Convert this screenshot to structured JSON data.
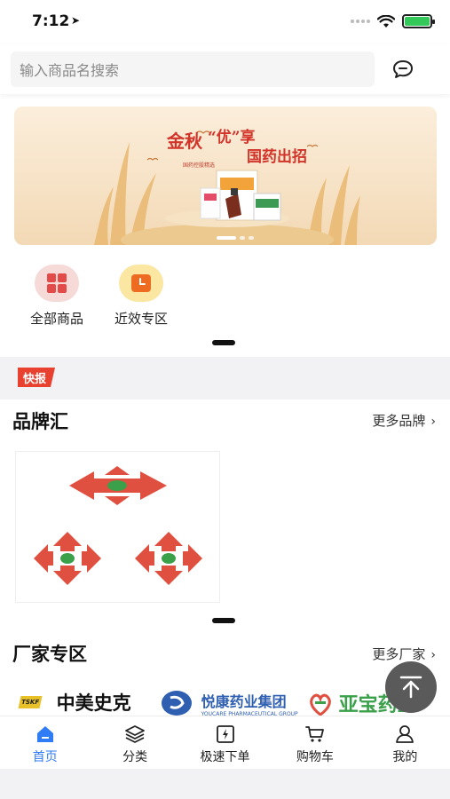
{
  "status": {
    "time": "7:12",
    "battery_level": 1.0
  },
  "search": {
    "placeholder": "输入商品名搜索",
    "chat_icon": "chat-bubble-icon"
  },
  "banner": {
    "headline_part1": "金秋",
    "headline_quote": "“优”享",
    "headline_part2": "国药出招",
    "sub": "国药控股精选",
    "slide_count": 3,
    "active_slide": 1
  },
  "quick_links": [
    {
      "label": "全部商品",
      "icon": "grid-icon",
      "color": "#f6dad8"
    },
    {
      "label": "近效专区",
      "icon": "clock-icon",
      "color": "#fbe6a2"
    }
  ],
  "news": {
    "badge": "快报"
  },
  "brands": {
    "title": "品牌汇",
    "more": "更多品牌"
  },
  "manufacturers": {
    "title": "厂家专区",
    "more": "更多厂家",
    "items": [
      {
        "name": "中美史克",
        "latin": "TSKF"
      },
      {
        "name": "悦康药业集团",
        "latin": "YOUCARE PHARMACEUTICAL GROUP"
      },
      {
        "name": "亚宝药业"
      }
    ]
  },
  "tabs": [
    {
      "label": "首页",
      "icon": "home-icon",
      "active": true
    },
    {
      "label": "分类",
      "icon": "layers-icon",
      "active": false
    },
    {
      "label": "极速下单",
      "icon": "quick-order-icon",
      "active": false
    },
    {
      "label": "购物车",
      "icon": "cart-icon",
      "active": false
    },
    {
      "label": "我的",
      "icon": "user-icon",
      "active": false
    }
  ],
  "colors": {
    "accent": "#2f7cf6",
    "badge": "#e8412f",
    "brand_red": "#e05040"
  }
}
